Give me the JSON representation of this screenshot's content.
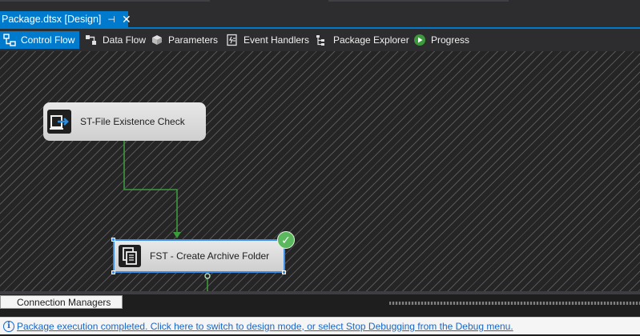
{
  "document_tab": {
    "title": "Package.dtsx [Design]",
    "pin_glyph": "⊣",
    "close_glyph": "✕"
  },
  "designer_tabs": [
    {
      "label": "Control Flow",
      "icon": "control-flow-icon",
      "active": true
    },
    {
      "label": "Data Flow",
      "icon": "data-flow-icon",
      "active": false
    },
    {
      "label": "Parameters",
      "icon": "parameters-icon",
      "active": false
    },
    {
      "label": "Event Handlers",
      "icon": "event-handlers-icon",
      "active": false
    },
    {
      "label": "Package Explorer",
      "icon": "package-explorer-icon",
      "active": false
    },
    {
      "label": "Progress",
      "icon": "progress-icon",
      "active": false
    }
  ],
  "canvas": {
    "tasks": [
      {
        "label": "ST-File Existence Check",
        "icon": "script-task-icon",
        "selected": false,
        "status": ""
      },
      {
        "label": "FST - Create Archive Folder",
        "icon": "file-system-task-icon",
        "selected": true,
        "status": "success"
      }
    ],
    "success_glyph": "✓",
    "precedence_color": "#3c9a3c"
  },
  "connection_managers": {
    "label": "Connection Managers"
  },
  "status_bar": {
    "info_glyph": "i",
    "message": "Package execution completed. Click here to switch to design mode, or select Stop Debugging from the Debug menu."
  },
  "colors": {
    "accent": "#007acc",
    "success": "#5cb85c",
    "link": "#1a66c6"
  }
}
